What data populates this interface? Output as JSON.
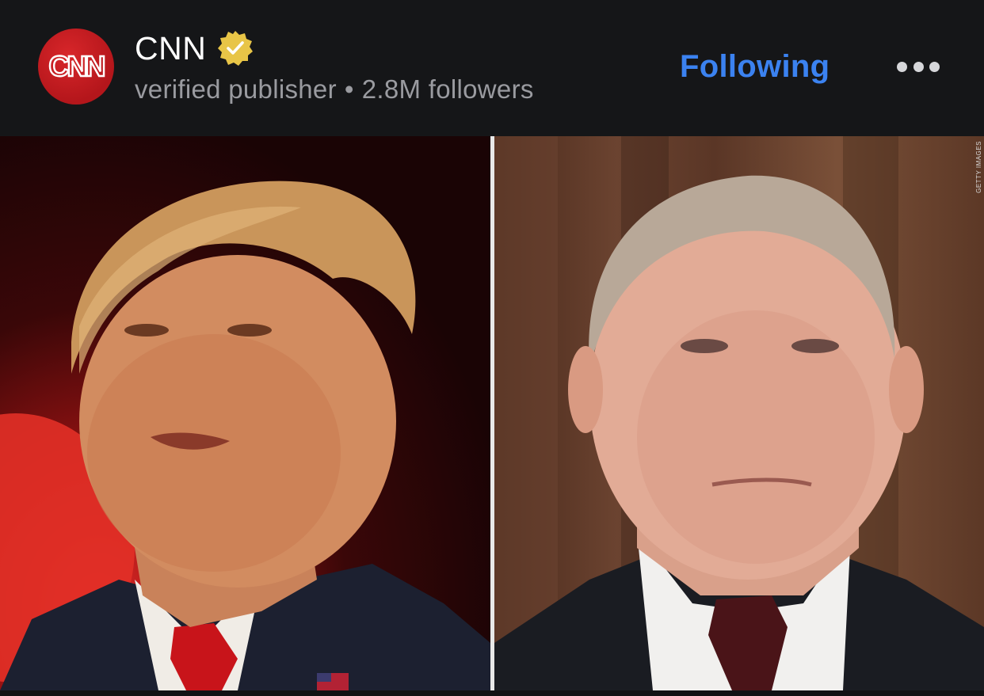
{
  "post": {
    "publisher_name": "CNN",
    "publisher_logo_text": "CNN",
    "publisher_type": "verified publisher",
    "separator": "•",
    "followers": "2.8M followers",
    "follow_label": "Following",
    "accent_color": "#3b82f0",
    "brand_color": "#cc1a1f",
    "badge_color": "#e8c547"
  },
  "icons": {
    "verified": "verified-badge-icon",
    "more": "more-options-icon"
  },
  "media": {
    "photo_credit": "GETTY IMAGES"
  }
}
